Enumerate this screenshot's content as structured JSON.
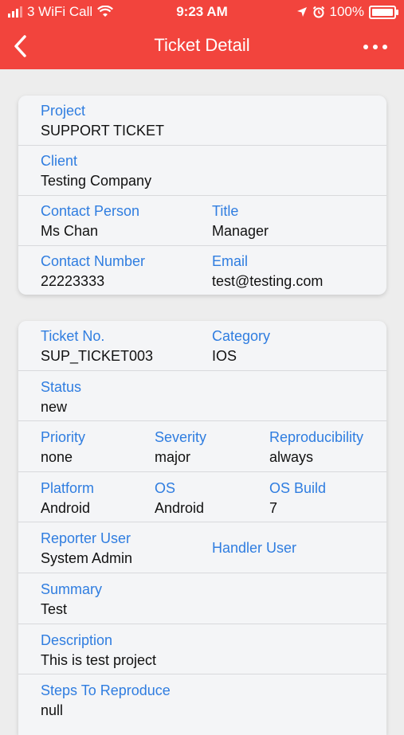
{
  "statusbar": {
    "carrier": "3 WiFi Call",
    "time": "9:23 AM",
    "battery": "100%"
  },
  "header": {
    "title": "Ticket Detail"
  },
  "card1": {
    "project_label": "Project",
    "project_value": "SUPPORT TICKET",
    "client_label": "Client",
    "client_value": "Testing Company",
    "contact_person_label": "Contact Person",
    "contact_person_value": "Ms Chan",
    "title_label": "Title",
    "title_value": "Manager",
    "contact_number_label": "Contact Number",
    "contact_number_value": "22223333",
    "email_label": "Email",
    "email_value": "test@testing.com"
  },
  "card2": {
    "ticket_no_label": "Ticket No.",
    "ticket_no_value": "SUP_TICKET003",
    "category_label": "Category",
    "category_value": "IOS",
    "status_label": "Status",
    "status_value": "new",
    "priority_label": "Priority",
    "priority_value": "none",
    "severity_label": "Severity",
    "severity_value": "major",
    "reproducibility_label": "Reproducibility",
    "reproducibility_value": "always",
    "platform_label": "Platform",
    "platform_value": "Android",
    "os_label": "OS",
    "os_value": "Android",
    "os_build_label": "OS Build",
    "os_build_value": "7",
    "reporter_user_label": "Reporter User",
    "reporter_user_value": "System Admin",
    "handler_user_label": "Handler User",
    "summary_label": "Summary",
    "summary_value": "Test",
    "description_label": "Description",
    "description_value": "This is test project",
    "steps_label": "Steps To Reproduce",
    "steps_value": "null"
  },
  "colors": {
    "header": "#f2443d",
    "label": "#2f7de0"
  },
  "icons": [
    "wifi-icon",
    "location-arrow-icon",
    "alarm-icon",
    "battery-icon",
    "back-chevron-icon",
    "more-icon"
  ]
}
